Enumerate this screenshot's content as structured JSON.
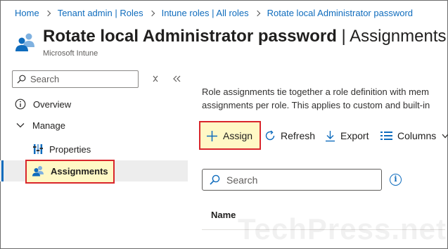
{
  "breadcrumb": [
    "Home",
    "Tenant admin | Roles",
    "Intune roles | All roles",
    "Rotate local Administrator password"
  ],
  "page": {
    "title_main": "Rotate local Administrator password",
    "title_separator": " | ",
    "title_section": "Assignments",
    "subtitle": "Microsoft Intune"
  },
  "sidebar": {
    "search_placeholder": "Search",
    "items": [
      {
        "label": "Overview",
        "icon": "info-circle-icon"
      },
      {
        "label": "Manage",
        "icon": "chevron-down-icon"
      },
      {
        "label": "Properties",
        "icon": "properties-icon"
      },
      {
        "label": "Assignments",
        "icon": "assignments-icon",
        "active": true
      }
    ]
  },
  "main": {
    "description_line1": "Role assignments tie together a role definition with mem",
    "description_line2": "assignments per role. This applies to custom and built-in",
    "toolbar": {
      "assign": "Assign",
      "refresh": "Refresh",
      "export": "Export",
      "columns": "Columns"
    },
    "search_placeholder": "Search",
    "table": {
      "columns": [
        "Name"
      ]
    }
  },
  "watermark": "TechPress.net",
  "colors": {
    "accent": "#0f6cbd",
    "highlight_border": "#d9262b",
    "highlight_fill": "#fff8c5",
    "active_row": "#ededed"
  }
}
